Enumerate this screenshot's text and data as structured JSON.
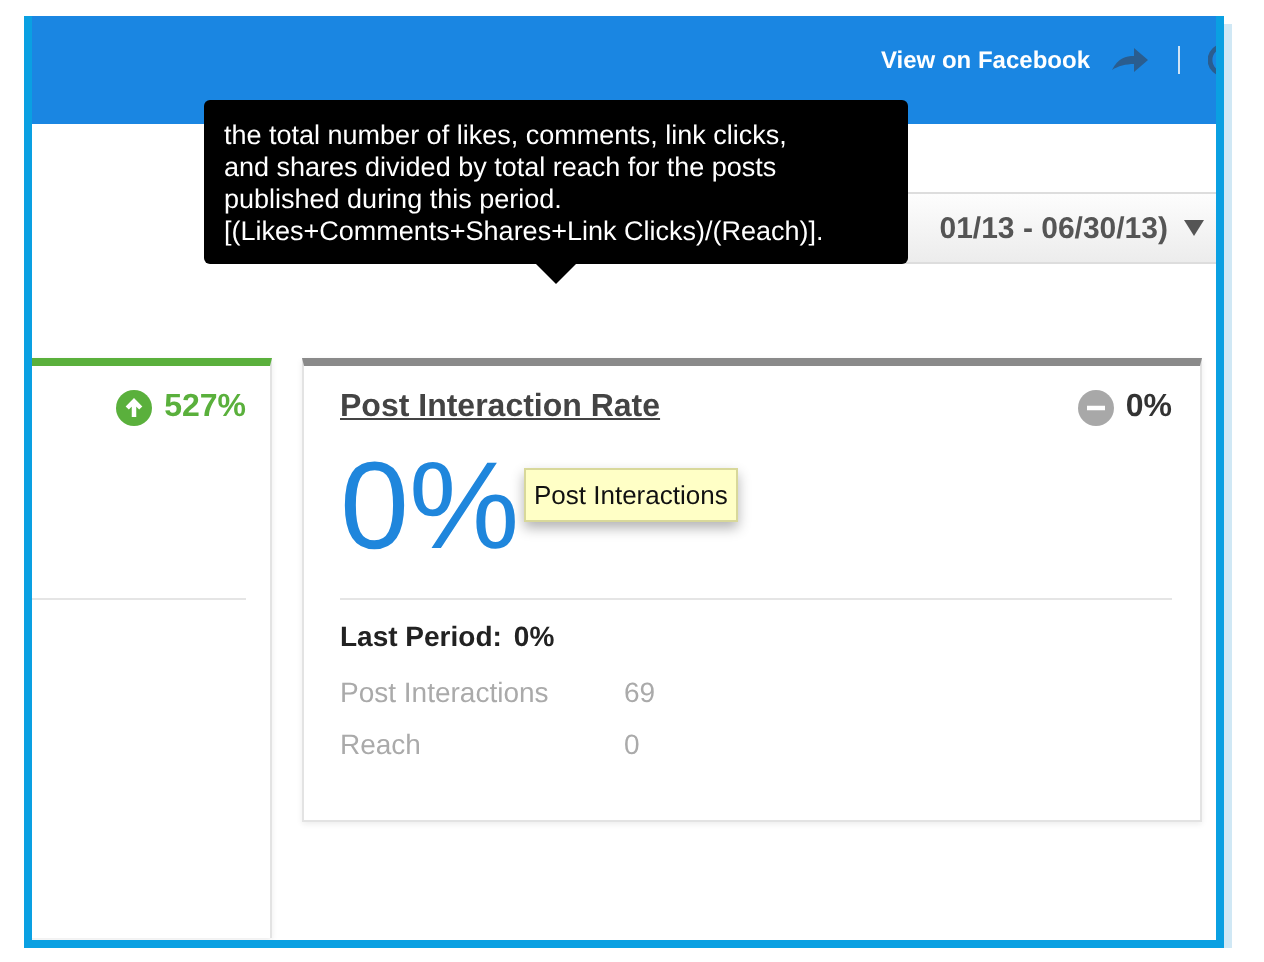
{
  "header": {
    "link": "View on Facebook"
  },
  "date_range": {
    "label": "01/13 - 06/30/13)"
  },
  "cards": [
    {
      "kind": "up",
      "change": "527%"
    },
    {
      "title": "Post Interaction Rate",
      "kind": "flat",
      "change": "0%",
      "value": "0%",
      "last_period_label": "Last Period:",
      "last_period_value": "0%",
      "stats": [
        {
          "label": "Post Interactions",
          "value": "69"
        },
        {
          "label": "Reach",
          "value": "0"
        }
      ]
    }
  ],
  "tooltip": {
    "text": "the total number of likes, comments, link clicks, and shares divided by total reach for the posts published during this period. [(Likes+Comments+Shares+Link Clicks)/(Reach)]."
  },
  "hover_tip": {
    "text": "Post Interactions"
  }
}
